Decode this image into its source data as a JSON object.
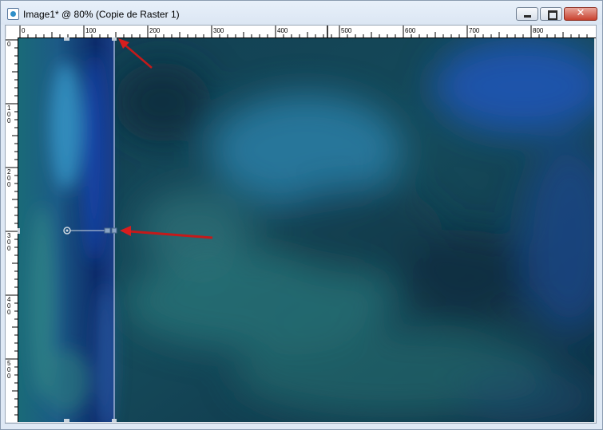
{
  "window": {
    "title": "Image1* @  80% (Copie de Raster 1)",
    "icon": "image-document-icon"
  },
  "ruler": {
    "h_labels": [
      "0",
      "100",
      "200",
      "300",
      "400",
      "500",
      "600",
      "700",
      "800"
    ],
    "v_labels": [
      "0",
      "100",
      "200",
      "300",
      "400",
      "500"
    ]
  },
  "selection": {
    "left_fraction": 0.166
  },
  "colors": {
    "accent_arrow": "#d81e1e",
    "image_dark": "#0c2f44",
    "image_teal": "#2f7f86",
    "image_blue": "#1b4fa0"
  }
}
